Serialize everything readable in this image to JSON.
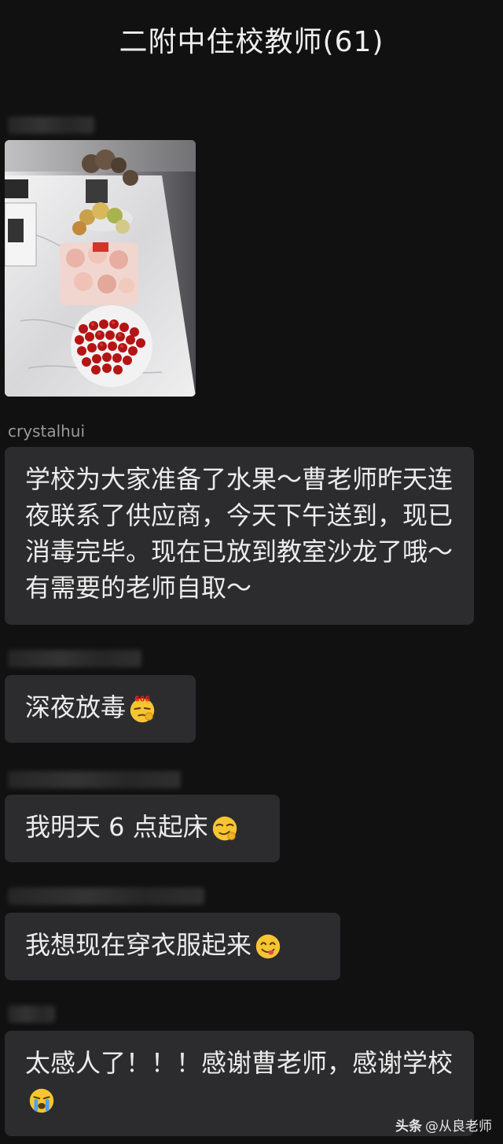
{
  "header": {
    "title": "二附中住校教师(61)"
  },
  "messages": [
    {
      "sender": "crystalhui",
      "text": "学校为大家准备了水果～曹老师昨天连夜联系了供应商，今天下午送到，现已消毒完毕。现在已放到教室沙龙了哦～有需要的老师自取～"
    },
    {
      "text": "深夜放毒",
      "emoji": "666-emoji-icon"
    },
    {
      "text": "我明天 6 点起床",
      "emoji": "smirk-emoji-icon"
    },
    {
      "text": "我想现在穿衣服起来",
      "emoji": "yum-emoji-icon"
    },
    {
      "text": "太感人了！！！感谢曹老师，感谢学校",
      "emoji": "crying-emoji-icon"
    }
  ],
  "watermark": {
    "logo": "头条",
    "handle": "@从良老师"
  },
  "colors": {
    "background": "#111111",
    "bubble": "#2c2c2e",
    "text": "#ececec"
  }
}
